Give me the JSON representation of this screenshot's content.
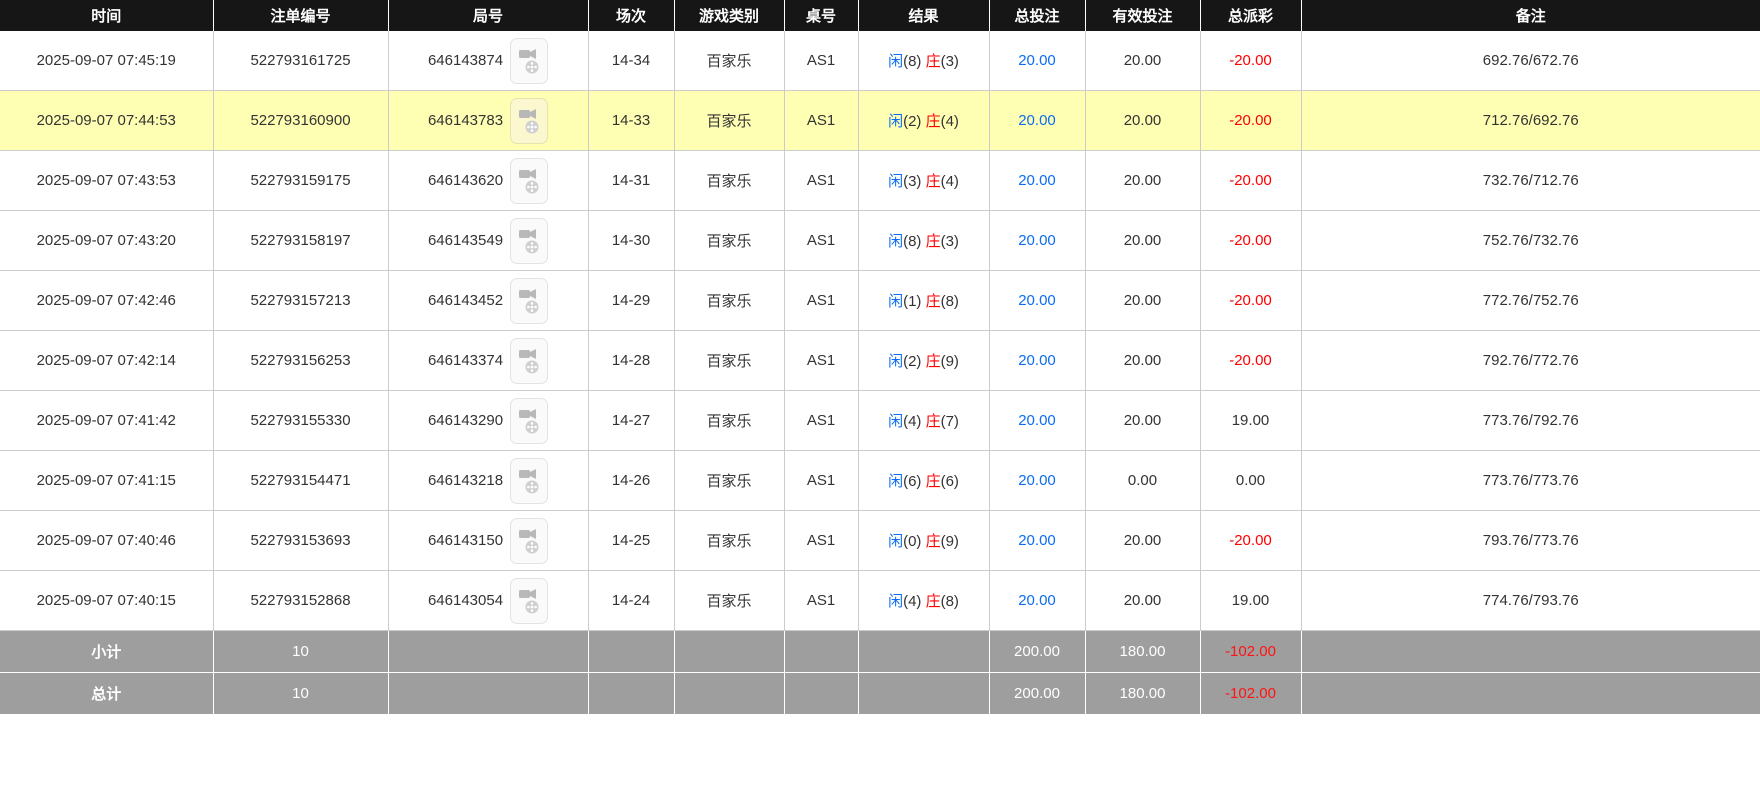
{
  "colors": {
    "header_bg": "#161616",
    "highlight_row": "#ffffb3",
    "footer_bg": "#9e9e9e",
    "blue": "#0c6cf2",
    "red": "#ff0000",
    "text": "#333333",
    "border": "#cccccc"
  },
  "table": {
    "headers": [
      "时间",
      "注单编号",
      "局号",
      "场次",
      "游戏类别",
      "桌号",
      "结果",
      "总投注",
      "有效投注",
      "总派彩",
      "备注"
    ],
    "result_labels": {
      "player": "闲",
      "banker": "庄"
    },
    "icons": {
      "round_video": "video-replay-icon"
    },
    "rows": [
      {
        "time": "2025-09-07 07:45:19",
        "bet_no": "522793161725",
        "round_no": "646143874",
        "session": "14-34",
        "game": "百家乐",
        "table_no": "AS1",
        "player": "8",
        "banker": "3",
        "total_bet": "20.00",
        "valid_bet": "20.00",
        "payout": "-20.00",
        "remark": "692.76/672.76",
        "highlight": false
      },
      {
        "time": "2025-09-07 07:44:53",
        "bet_no": "522793160900",
        "round_no": "646143783",
        "session": "14-33",
        "game": "百家乐",
        "table_no": "AS1",
        "player": "2",
        "banker": "4",
        "total_bet": "20.00",
        "valid_bet": "20.00",
        "payout": "-20.00",
        "remark": "712.76/692.76",
        "highlight": true
      },
      {
        "time": "2025-09-07 07:43:53",
        "bet_no": "522793159175",
        "round_no": "646143620",
        "session": "14-31",
        "game": "百家乐",
        "table_no": "AS1",
        "player": "3",
        "banker": "4",
        "total_bet": "20.00",
        "valid_bet": "20.00",
        "payout": "-20.00",
        "remark": "732.76/712.76",
        "highlight": false
      },
      {
        "time": "2025-09-07 07:43:20",
        "bet_no": "522793158197",
        "round_no": "646143549",
        "session": "14-30",
        "game": "百家乐",
        "table_no": "AS1",
        "player": "8",
        "banker": "3",
        "total_bet": "20.00",
        "valid_bet": "20.00",
        "payout": "-20.00",
        "remark": "752.76/732.76",
        "highlight": false
      },
      {
        "time": "2025-09-07 07:42:46",
        "bet_no": "522793157213",
        "round_no": "646143452",
        "session": "14-29",
        "game": "百家乐",
        "table_no": "AS1",
        "player": "1",
        "banker": "8",
        "total_bet": "20.00",
        "valid_bet": "20.00",
        "payout": "-20.00",
        "remark": "772.76/752.76",
        "highlight": false
      },
      {
        "time": "2025-09-07 07:42:14",
        "bet_no": "522793156253",
        "round_no": "646143374",
        "session": "14-28",
        "game": "百家乐",
        "table_no": "AS1",
        "player": "2",
        "banker": "9",
        "total_bet": "20.00",
        "valid_bet": "20.00",
        "payout": "-20.00",
        "remark": "792.76/772.76",
        "highlight": false
      },
      {
        "time": "2025-09-07 07:41:42",
        "bet_no": "522793155330",
        "round_no": "646143290",
        "session": "14-27",
        "game": "百家乐",
        "table_no": "AS1",
        "player": "4",
        "banker": "7",
        "total_bet": "20.00",
        "valid_bet": "20.00",
        "payout": "19.00",
        "remark": "773.76/792.76",
        "highlight": false
      },
      {
        "time": "2025-09-07 07:41:15",
        "bet_no": "522793154471",
        "round_no": "646143218",
        "session": "14-26",
        "game": "百家乐",
        "table_no": "AS1",
        "player": "6",
        "banker": "6",
        "total_bet": "20.00",
        "valid_bet": "0.00",
        "payout": "0.00",
        "remark": "773.76/773.76",
        "highlight": false
      },
      {
        "time": "2025-09-07 07:40:46",
        "bet_no": "522793153693",
        "round_no": "646143150",
        "session": "14-25",
        "game": "百家乐",
        "table_no": "AS1",
        "player": "0",
        "banker": "9",
        "total_bet": "20.00",
        "valid_bet": "20.00",
        "payout": "-20.00",
        "remark": "793.76/773.76",
        "highlight": false
      },
      {
        "time": "2025-09-07 07:40:15",
        "bet_no": "522793152868",
        "round_no": "646143054",
        "session": "14-24",
        "game": "百家乐",
        "table_no": "AS1",
        "player": "4",
        "banker": "8",
        "total_bet": "20.00",
        "valid_bet": "20.00",
        "payout": "19.00",
        "remark": "774.76/793.76",
        "highlight": false
      }
    ],
    "footer": [
      {
        "label": "小计",
        "count": "10",
        "total_bet": "200.00",
        "valid_bet": "180.00",
        "payout": "-102.00"
      },
      {
        "label": "总计",
        "count": "10",
        "total_bet": "200.00",
        "valid_bet": "180.00",
        "payout": "-102.00"
      }
    ]
  }
}
